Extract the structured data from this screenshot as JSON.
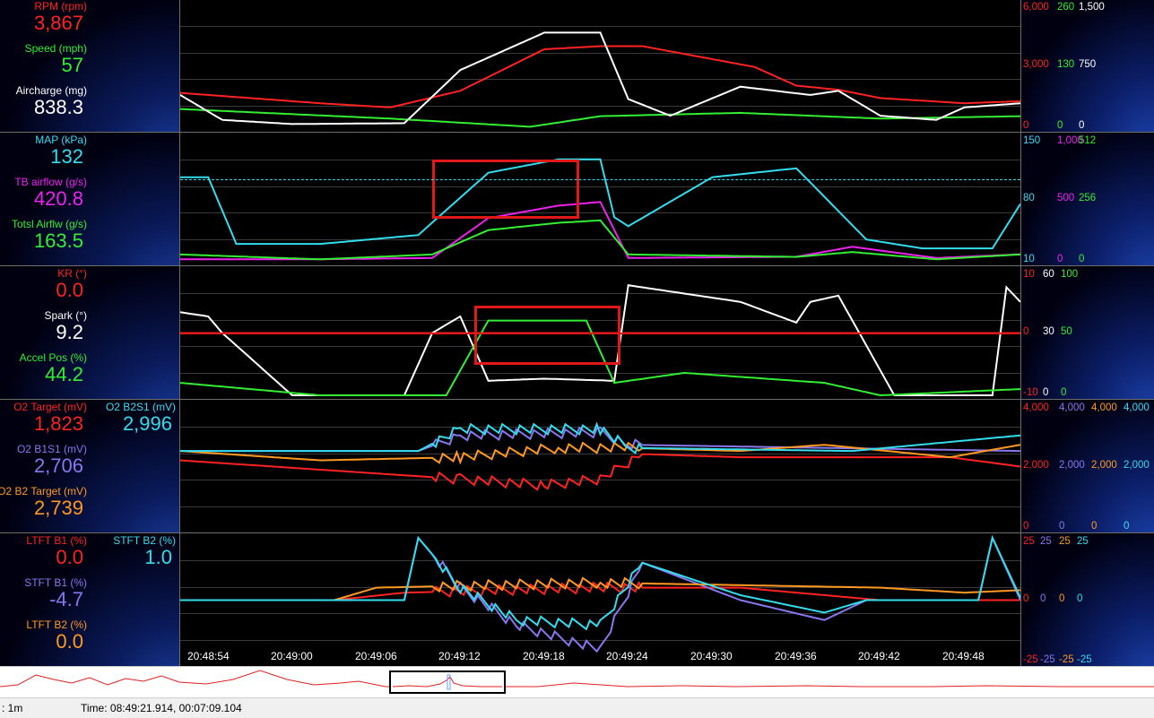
{
  "panels": [
    {
      "left_channels": [
        {
          "label": "RPM (rpm)",
          "value": "3,867",
          "color": "#ff2222"
        },
        {
          "label": "Speed (mph)",
          "value": "57",
          "color": "#33ee33"
        },
        {
          "label": "Aircharge (mg)",
          "value": "838.3",
          "color": "#ffffff"
        }
      ],
      "scales": [
        {
          "color": "#ff2222",
          "ticks": [
            "6,000",
            "3,000",
            "0"
          ]
        },
        {
          "color": "#33ee33",
          "ticks": [
            "260",
            "130",
            "0"
          ]
        },
        {
          "color": "#ffffff",
          "ticks": [
            "1,500",
            "750",
            "0"
          ]
        }
      ]
    },
    {
      "left_channels": [
        {
          "label": "MAP (kPa)",
          "value": "132",
          "color": "#33ddee"
        },
        {
          "label": "TB airflow (g/s)",
          "value": "420.8",
          "color": "#ee22ee"
        },
        {
          "label": "Totsl Airflw (g/s)",
          "value": "163.5",
          "color": "#33ee33"
        }
      ],
      "scales": [
        {
          "color": "#33ddee",
          "ticks": [
            "150",
            "80",
            "10"
          ]
        },
        {
          "color": "#ee22ee",
          "ticks": [
            "1,000",
            "500",
            "0"
          ]
        },
        {
          "color": "#33ee33",
          "ticks": [
            "512",
            "256",
            "0"
          ]
        }
      ]
    },
    {
      "left_channels": [
        {
          "label": "KR (°)",
          "value": "0.0",
          "color": "#ff2222"
        },
        {
          "label": "Spark (°)",
          "value": "9.2",
          "color": "#ffffff"
        },
        {
          "label": "Accel Pos (%)",
          "value": "44.2",
          "color": "#33ee33"
        }
      ],
      "scales": [
        {
          "color": "#ff2222",
          "ticks": [
            "10",
            "0",
            "-10"
          ]
        },
        {
          "color": "#ffffff",
          "ticks": [
            "60",
            "30",
            "0"
          ]
        },
        {
          "color": "#33ee33",
          "ticks": [
            "100",
            "50",
            "0"
          ]
        }
      ]
    },
    {
      "left_channels": [
        {
          "label": "O2 Target (mV)",
          "value": "1,823",
          "color": "#ff2222"
        },
        {
          "label": "O2 B1S1 (mV)",
          "value": "2,706",
          "color": "#8877ee"
        },
        {
          "label": "O2 B2 Target (mV)",
          "value": "2,739",
          "color": "#ff9922"
        }
      ],
      "right_channels": [
        {
          "label": "O2 B2S1 (mV)",
          "value": "2,996",
          "color": "#33ddee"
        }
      ],
      "scales": [
        {
          "color": "#ff2222",
          "ticks": [
            "4,000",
            "2,000",
            "0"
          ]
        },
        {
          "color": "#8877ee",
          "ticks": [
            "4,000",
            "2,000",
            "0"
          ]
        },
        {
          "color": "#ff9922",
          "ticks": [
            "4,000",
            "2,000",
            "0"
          ]
        },
        {
          "color": "#33ddee",
          "ticks": [
            "4,000",
            "2,000",
            "0"
          ]
        }
      ]
    },
    {
      "left_channels": [
        {
          "label": "LTFT B1 (%)",
          "value": "0.0",
          "color": "#ff2222"
        },
        {
          "label": "STFT B1 (%)",
          "value": "-4.7",
          "color": "#8877ee"
        },
        {
          "label": "LTFT B2 (%)",
          "value": "0.0",
          "color": "#ff9922"
        }
      ],
      "right_channels": [
        {
          "label": "STFT B2 (%)",
          "value": "1.0",
          "color": "#33ddee"
        }
      ],
      "scales": [
        {
          "color": "#ff2222",
          "ticks": [
            "25",
            "0",
            "-25"
          ]
        },
        {
          "color": "#8877ee",
          "ticks": [
            "25",
            "0",
            "-25"
          ]
        },
        {
          "color": "#ff9922",
          "ticks": [
            "25",
            "0",
            "-25"
          ]
        },
        {
          "color": "#33ddee",
          "ticks": [
            "25",
            "0",
            "-25"
          ]
        }
      ]
    }
  ],
  "time_axis": [
    "20:48:54",
    "20:49:00",
    "20:49:06",
    "20:49:12",
    "20:49:18",
    "20:49:24",
    "20:49:30",
    "20:49:36",
    "20:49:42",
    "20:49:48"
  ],
  "status_bar": {
    "zoom": ": 1m",
    "time": "Time: 08:49:21.914, 00:07:09.104"
  },
  "chart_data": {
    "type": "line",
    "x_unit": "time",
    "x_range": [
      "20:48:51",
      "20:49:51"
    ],
    "series": [
      {
        "name": "RPM (rpm)",
        "panel": 0,
        "ylim": [
          0,
          6000
        ],
        "t": [
          0,
          10,
          15,
          20,
          26,
          30,
          33,
          41,
          44,
          47,
          50,
          56,
          60
        ],
        "values": [
          1700,
          1200,
          1000,
          1800,
          3800,
          3950,
          3950,
          2950,
          2050,
          1850,
          1450,
          1200,
          1300
        ]
      },
      {
        "name": "Speed (mph)",
        "panel": 0,
        "ylim": [
          0,
          260
        ],
        "t": [
          0,
          15,
          25,
          30,
          40,
          50,
          60
        ],
        "values": [
          40,
          20,
          3,
          25,
          32,
          20,
          25
        ]
      },
      {
        "name": "Aircharge (mg)",
        "panel": 0,
        "ylim": [
          0,
          1500
        ],
        "t": [
          0,
          3,
          8,
          16,
          20,
          26,
          30,
          32,
          35,
          40,
          45,
          47,
          50,
          54,
          56,
          60
        ],
        "values": [
          400,
          100,
          50,
          60,
          700,
          1150,
          1150,
          350,
          150,
          500,
          400,
          450,
          150,
          100,
          250,
          300
        ]
      },
      {
        "name": "MAP (kPa)",
        "panel": 1,
        "ylim": [
          10,
          150
        ],
        "t": [
          0,
          2,
          4,
          10,
          17,
          22,
          27,
          30,
          31,
          32,
          38,
          44,
          49,
          53,
          58,
          60
        ],
        "values": [
          105,
          105,
          30,
          30,
          40,
          110,
          125,
          125,
          60,
          50,
          105,
          115,
          35,
          25,
          25,
          75
        ]
      },
      {
        "name": "TB airflow (g/s)",
        "panel": 1,
        "ylim": [
          0,
          1000
        ],
        "t": [
          0,
          10,
          18,
          22,
          27,
          30,
          32,
          44,
          48,
          54,
          60
        ],
        "values": [
          20,
          20,
          30,
          350,
          450,
          480,
          30,
          40,
          120,
          30,
          60
        ]
      },
      {
        "name": "Totsl Airflw (g/s)",
        "panel": 1,
        "ylim": [
          0,
          512
        ],
        "t": [
          0,
          10,
          18,
          22,
          27,
          30,
          32,
          44,
          48,
          54,
          60
        ],
        "values": [
          30,
          10,
          30,
          130,
          160,
          170,
          30,
          20,
          40,
          10,
          30
        ]
      },
      {
        "name": "KR (°)",
        "panel": 2,
        "ylim": [
          -10,
          10
        ],
        "t": [
          0,
          60
        ],
        "values": [
          0,
          0
        ]
      },
      {
        "name": "Spark (°)",
        "panel": 2,
        "ylim": [
          0,
          60
        ],
        "t": [
          0,
          2,
          3,
          8,
          16,
          18,
          20,
          22,
          26,
          31,
          32,
          40,
          44,
          45,
          47,
          51,
          52,
          58,
          59,
          60
        ],
        "values": [
          40,
          38,
          30,
          0,
          0,
          30,
          38,
          7,
          8,
          7,
          53,
          45,
          35,
          45,
          48,
          0,
          0,
          0,
          52,
          45
        ]
      },
      {
        "name": "Accel Pos (%)",
        "panel": 2,
        "ylim": [
          0,
          100
        ],
        "t": [
          0,
          10,
          19,
          22,
          29,
          31,
          36,
          46,
          50,
          60
        ],
        "values": [
          10,
          0,
          0,
          60,
          60,
          10,
          18,
          10,
          0,
          5
        ]
      },
      {
        "name": "O2 Target (mV)",
        "panel": 3,
        "ylim": [
          0,
          4000
        ],
        "t": [
          0,
          10,
          20,
          26,
          30,
          33,
          40,
          45,
          55,
          60
        ],
        "values": [
          2200,
          1900,
          1600,
          1400,
          1600,
          2400,
          2300,
          2300,
          2300,
          2000
        ]
      },
      {
        "name": "O2 B1S1 (mV)",
        "panel": 3,
        "ylim": [
          0,
          4000
        ],
        "t": [
          0,
          17,
          20,
          30,
          32,
          60
        ],
        "values": [
          2500,
          2500,
          3000,
          3100,
          2700,
          2500
        ]
      },
      {
        "name": "O2 B2 Target (mV)",
        "panel": 3,
        "ylim": [
          0,
          4000
        ],
        "t": [
          0,
          10,
          20,
          27,
          32,
          40,
          46,
          55,
          60
        ],
        "values": [
          2500,
          2200,
          2300,
          2600,
          2600,
          2500,
          2700,
          2300,
          2700
        ]
      },
      {
        "name": "O2 B2S1 (mV)",
        "panel": 3,
        "ylim": [
          0,
          4000
        ],
        "t": [
          0,
          17,
          20,
          30,
          32,
          48,
          60
        ],
        "values": [
          2500,
          2500,
          3200,
          3200,
          2600,
          2500,
          3000
        ]
      },
      {
        "name": "LTFT B1 (%)",
        "panel": 4,
        "ylim": [
          -25,
          25
        ],
        "t": [
          0,
          11,
          16,
          30,
          40,
          50,
          60
        ],
        "values": [
          0,
          0,
          3,
          5,
          5,
          0,
          0
        ]
      },
      {
        "name": "STFT B1 (%)",
        "panel": 4,
        "ylim": [
          -25,
          25
        ],
        "t": [
          0,
          16,
          17,
          20,
          24,
          30,
          33,
          40,
          46,
          49,
          57,
          58,
          60
        ],
        "values": [
          0,
          0,
          25,
          5,
          -10,
          -20,
          15,
          0,
          -8,
          0,
          0,
          25,
          0
        ]
      },
      {
        "name": "LTFT B2 (%)",
        "panel": 4,
        "ylim": [
          -25,
          25
        ],
        "t": [
          0,
          11,
          14,
          30,
          40,
          50,
          56,
          60
        ],
        "values": [
          0,
          0,
          5,
          7,
          6,
          5,
          3,
          4
        ]
      },
      {
        "name": "STFT B2 (%)",
        "panel": 4,
        "ylim": [
          -25,
          25
        ],
        "t": [
          0,
          16,
          17,
          20,
          24,
          30,
          33,
          40,
          46,
          49,
          57,
          58,
          60
        ],
        "values": [
          0,
          0,
          25,
          5,
          -8,
          -10,
          15,
          2,
          -5,
          0,
          0,
          25,
          1
        ]
      }
    ]
  }
}
